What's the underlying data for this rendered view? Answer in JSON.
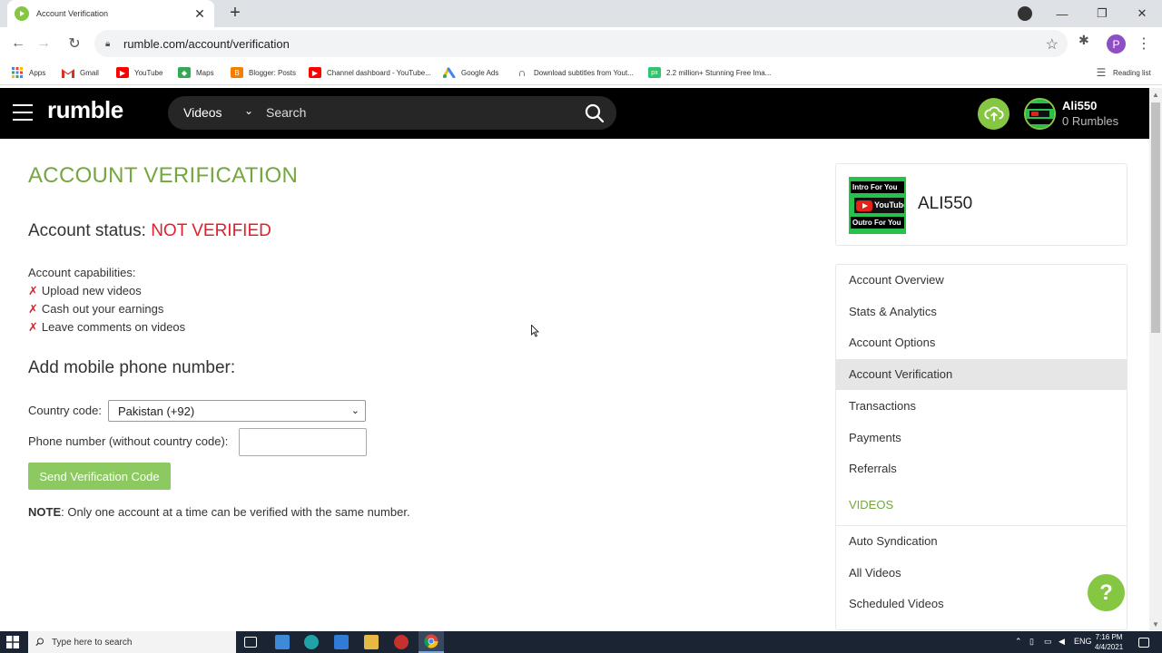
{
  "browser": {
    "tab_title": "Account Verification",
    "url": "rumble.com/account/verification",
    "profile_initial": "P",
    "bookmarks": [
      {
        "label": "Apps",
        "icon": "apps-grid-icon",
        "color": "#4285f4"
      },
      {
        "label": "Gmail",
        "icon": "gmail-icon",
        "color": "#d93025"
      },
      {
        "label": "YouTube",
        "icon": "youtube-icon",
        "color": "#ff0000"
      },
      {
        "label": "Maps",
        "icon": "maps-icon",
        "color": "#34a853"
      },
      {
        "label": "Blogger: Posts",
        "icon": "blogger-icon",
        "color": "#f57d00"
      },
      {
        "label": "Channel dashboard - YouTube...",
        "icon": "youtube-icon",
        "color": "#ff0000"
      },
      {
        "label": "Google Ads",
        "icon": "google-ads-icon",
        "color": "#fbbc04"
      },
      {
        "label": "Download subtitles from Yout...",
        "icon": "download-icon",
        "color": "#333333"
      },
      {
        "label": "2.2 million+ Stunning Free Ima...",
        "icon": "pixabay-icon",
        "color": "#2ec66d"
      }
    ],
    "reading_list": "Reading list"
  },
  "site": {
    "logo": "rumble",
    "search_category": "Videos",
    "search_placeholder": "Search",
    "user_name": "Ali550",
    "user_rumbles": "0 Rumbles",
    "brand_color": "#85c742"
  },
  "main": {
    "title": "ACCOUNT VERIFICATION",
    "status_label": "Account status:",
    "status_value": "NOT VERIFIED",
    "capabilities_label": "Account capabilities:",
    "capabilities": [
      {
        "mark": "✗",
        "text": "Upload new videos"
      },
      {
        "mark": "✗",
        "text": "Cash out your earnings"
      },
      {
        "mark": "✗",
        "text": "Leave comments on videos"
      }
    ],
    "add_phone_heading": "Add mobile phone number:",
    "country_code_label": "Country code:",
    "country_code_value": "Pakistan (+92)",
    "phone_label": "Phone number (without country code):",
    "phone_value": "",
    "send_button": "Send Verification Code",
    "note_label": "NOTE",
    "note_text": ": Only one account at a time can be verified with the same number."
  },
  "sidebar": {
    "profile_name": "ALI550",
    "thumb_top": "Intro For You",
    "thumb_mid": "YouTube",
    "thumb_bottom": "Outro For You",
    "menu": [
      {
        "label": "Account Overview",
        "active": false
      },
      {
        "label": "Stats & Analytics",
        "active": false
      },
      {
        "label": "Account Options",
        "active": false
      },
      {
        "label": "Account Verification",
        "active": true
      },
      {
        "label": "Transactions",
        "active": false
      },
      {
        "label": "Payments",
        "active": false
      },
      {
        "label": "Referrals",
        "active": false
      }
    ],
    "videos_section": "VIDEOS",
    "videos_menu": [
      {
        "label": "Auto Syndication"
      },
      {
        "label": "All Videos"
      },
      {
        "label": "Scheduled Videos"
      }
    ],
    "help": "?"
  },
  "taskbar": {
    "search_placeholder": "Type here to search",
    "lang": "ENG",
    "time": "7:16 PM",
    "date": "4/4/2021"
  }
}
